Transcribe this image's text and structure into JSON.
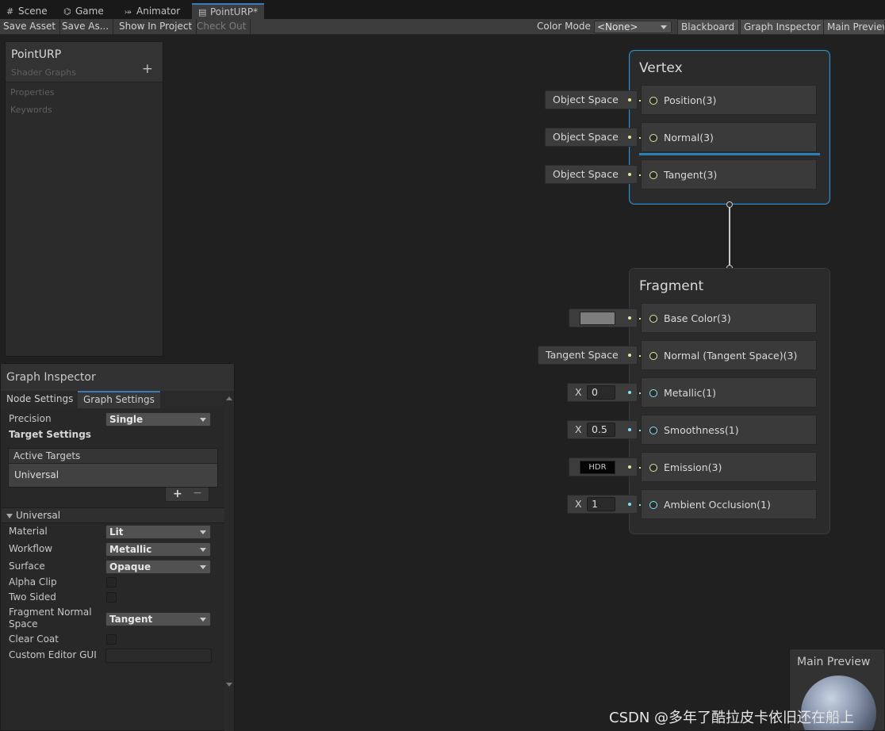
{
  "tabs": [
    {
      "label": "Scene",
      "icon": "grid-icon"
    },
    {
      "label": "Game",
      "icon": "gamepad-icon"
    },
    {
      "label": "Animator",
      "icon": "animator-icon"
    },
    {
      "label": "PointURP*",
      "icon": "shader-graph-icon"
    }
  ],
  "toolbar": {
    "save_asset": "Save Asset",
    "save_as": "Save As...",
    "show_in_project": "Show In Project",
    "check_out": "Check Out",
    "color_mode_label": "Color Mode",
    "color_mode_value": "<None>",
    "blackboard": "Blackboard",
    "graph_inspector": "Graph Inspector",
    "main_preview": "Main Preview"
  },
  "blackboard": {
    "title": "PointURP",
    "subtitle": "Shader Graphs",
    "add": "+",
    "properties": "Properties",
    "keywords": "Keywords"
  },
  "inspector": {
    "title": "Graph Inspector",
    "tabs": [
      "Node Settings",
      "Graph Settings"
    ],
    "precision_label": "Precision",
    "precision_value": "Single",
    "target_settings": "Target Settings",
    "active_targets": "Active Targets",
    "target_universal": "Universal",
    "add": "+",
    "remove": "−",
    "universal_section": "Universal",
    "material_label": "Material",
    "material_value": "Lit",
    "workflow_label": "Workflow",
    "workflow_value": "Metallic",
    "surface_label": "Surface",
    "surface_value": "Opaque",
    "alpha_clip_label": "Alpha Clip",
    "two_sided_label": "Two Sided",
    "fragment_normal_label_1": "Fragment Normal",
    "fragment_normal_label_2": "Space",
    "fragment_normal_value": "Tangent",
    "clear_coat_label": "Clear Coat",
    "custom_editor_label": "Custom Editor GUI"
  },
  "vertex": {
    "title": "Vertex",
    "blocks": [
      {
        "label": "Position(3)",
        "input": "Object Space"
      },
      {
        "label": "Normal(3)",
        "input": "Object Space"
      },
      {
        "label": "Tangent(3)",
        "input": "Object Space"
      }
    ]
  },
  "fragment": {
    "title": "Fragment",
    "blocks": [
      {
        "label": "Base Color(3)"
      },
      {
        "label": "Normal (Tangent Space)(3)",
        "input": "Tangent Space"
      },
      {
        "label": "Metallic(1)",
        "x_label": "X",
        "value": "0"
      },
      {
        "label": "Smoothness(1)",
        "x_label": "X",
        "value": "0.5"
      },
      {
        "label": "Emission(3)",
        "hdr": "HDR"
      },
      {
        "label": "Ambient Occlusion(1)",
        "x_label": "X",
        "value": "1"
      }
    ]
  },
  "preview": {
    "title": "Main Preview"
  },
  "watermark": "CSDN @多年了酷拉皮卡依旧还在船上",
  "colors": {
    "accent": "#3a79bb",
    "vector3_port": "#e8e8a0",
    "float_port": "#84e4f7",
    "base_color": "#7d7d7d"
  }
}
